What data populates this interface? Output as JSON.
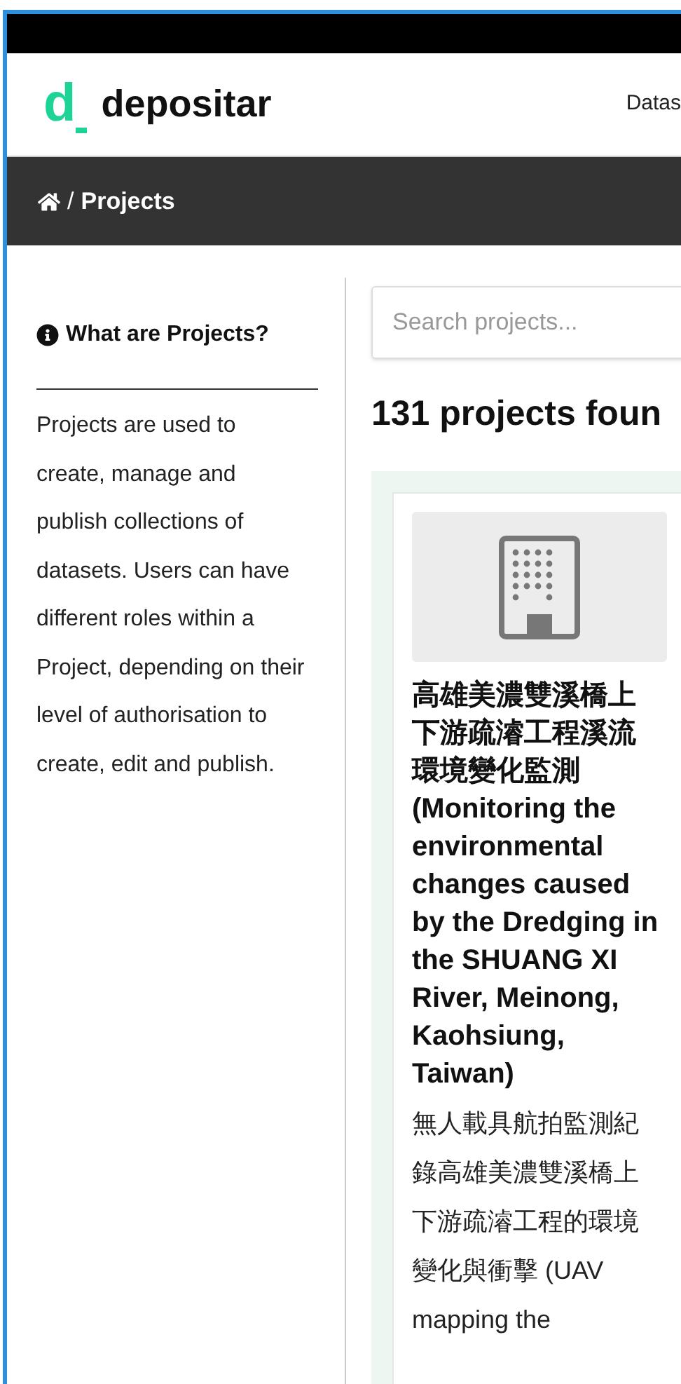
{
  "header": {
    "logo": {
      "mark": "d",
      "text": "depositar"
    },
    "nav": [
      "Datas"
    ]
  },
  "breadcrumb": {
    "separator": "/",
    "items": [
      "Projects"
    ]
  },
  "sidebar": {
    "title": "What are Projects?",
    "body": "Projects are used to create, manage and publish collections of datasets. Users can have different roles within a Project, depending on their level of authorisation to create, edit and publish."
  },
  "search": {
    "placeholder": "Search projects..."
  },
  "results_heading": "131 projects foun",
  "projects": [
    {
      "title": "高雄美濃雙溪橋上下游疏濬工程溪流環境變化監測 (Monitoring the environmental changes caused by the Dredging in the SHUANG XI River, Meinong, Kaohsiung, Taiwan)",
      "description": "無人載具航拍監測紀錄高雄美濃雙溪橋上下游疏濬工程的環境變化與衝擊 (UAV mapping the"
    }
  ]
}
